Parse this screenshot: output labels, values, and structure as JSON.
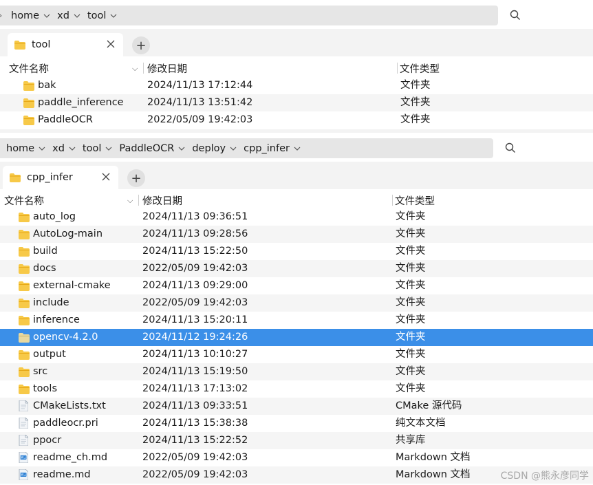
{
  "colors": {
    "folder": "#f7c948",
    "folder_dark": "#e6a817",
    "selected_row": "#3b8fe8",
    "addr_bg": "#e6e6e6"
  },
  "window1": {
    "breadcrumbs": [
      "home",
      "xd",
      "tool"
    ],
    "tab": {
      "label": "tool"
    },
    "columns": {
      "name": "文件名称",
      "date": "修改日期",
      "type": "文件类型"
    },
    "rows": [
      {
        "name": "bak",
        "date": "2024/11/13 17:12:44",
        "type": "文件夹",
        "icon": "folder-icon"
      },
      {
        "name": "paddle_inference",
        "date": "2024/11/13 13:51:42",
        "type": "文件夹",
        "icon": "folder-icon"
      },
      {
        "name": "PaddleOCR",
        "date": "2022/05/09 19:42:03",
        "type": "文件夹",
        "icon": "folder-icon"
      }
    ]
  },
  "window2": {
    "breadcrumbs": [
      "home",
      "xd",
      "tool",
      "PaddleOCR",
      "deploy",
      "cpp_infer"
    ],
    "tab": {
      "label": "cpp_infer"
    },
    "columns": {
      "name": "文件名称",
      "date": "修改日期",
      "type": "文件类型"
    },
    "rows": [
      {
        "name": "auto_log",
        "date": "2024/11/13 09:36:51",
        "type": "文件夹",
        "icon": "folder-icon"
      },
      {
        "name": "AutoLog-main",
        "date": "2024/11/13 09:28:56",
        "type": "文件夹",
        "icon": "folder-icon"
      },
      {
        "name": "build",
        "date": "2024/11/13 15:22:50",
        "type": "文件夹",
        "icon": "folder-icon"
      },
      {
        "name": "docs",
        "date": "2022/05/09 19:42:03",
        "type": "文件夹",
        "icon": "folder-icon"
      },
      {
        "name": "external-cmake",
        "date": "2024/11/13 09:29:00",
        "type": "文件夹",
        "icon": "folder-icon"
      },
      {
        "name": "include",
        "date": "2022/05/09 19:42:03",
        "type": "文件夹",
        "icon": "folder-icon"
      },
      {
        "name": "inference",
        "date": "2024/11/13 15:20:11",
        "type": "文件夹",
        "icon": "folder-icon"
      },
      {
        "name": "opencv-4.2.0",
        "date": "2024/11/12 19:24:26",
        "type": "文件夹",
        "icon": "folder-icon",
        "selected": true
      },
      {
        "name": "output",
        "date": "2024/11/13 10:10:27",
        "type": "文件夹",
        "icon": "folder-icon"
      },
      {
        "name": "src",
        "date": "2024/11/13 15:19:50",
        "type": "文件夹",
        "icon": "folder-icon"
      },
      {
        "name": "tools",
        "date": "2024/11/13 17:13:02",
        "type": "文件夹",
        "icon": "folder-icon"
      },
      {
        "name": "CMakeLists.txt",
        "date": "2024/11/13 09:33:51",
        "type": "CMake 源代码",
        "icon": "file-icon"
      },
      {
        "name": "paddleocr.pri",
        "date": "2024/11/13 15:38:38",
        "type": "纯文本文档",
        "icon": "file-icon"
      },
      {
        "name": "ppocr",
        "date": "2024/11/13 15:22:52",
        "type": "共享库",
        "icon": "file-icon"
      },
      {
        "name": "readme_ch.md",
        "date": "2022/05/09 19:42:03",
        "type": "Markdown 文档",
        "icon": "markdown-file-icon"
      },
      {
        "name": "readme.md",
        "date": "2022/05/09 19:42:03",
        "type": "Markdown 文档",
        "icon": "markdown-file-icon"
      }
    ]
  },
  "watermark": "CSDN @熊永彦同学"
}
